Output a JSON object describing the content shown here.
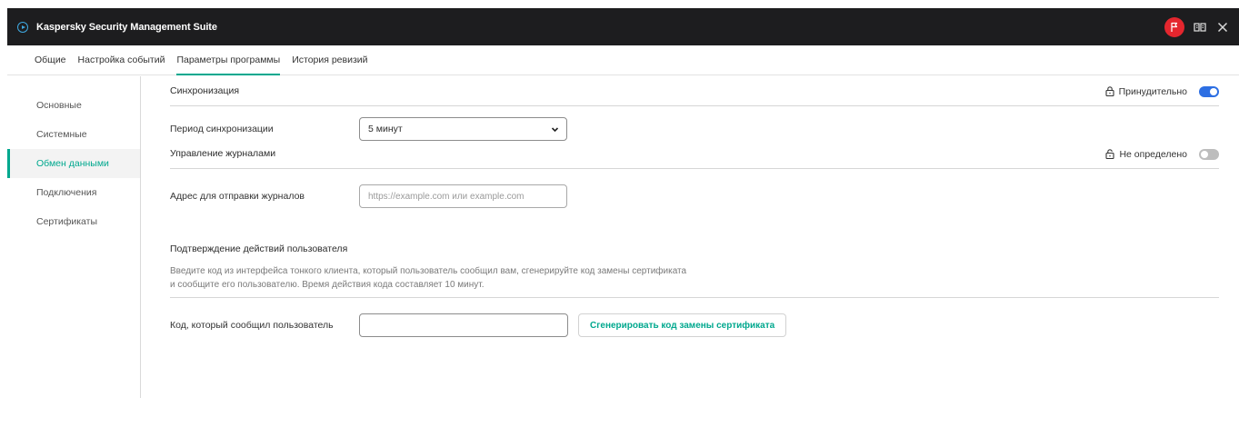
{
  "app": {
    "title": "Kaspersky Security Management Suite",
    "icons": [
      "play-circle-icon",
      "flag-icon",
      "book-icon",
      "close-icon"
    ],
    "colors": {
      "titlebar": "#1d1d1f",
      "accent": "#00a88e",
      "toggle_on": "#2d6fe3",
      "badge": "#e4262e"
    }
  },
  "tabs": [
    {
      "label": "Общие"
    },
    {
      "label": "Настройка событий"
    },
    {
      "label": "Параметры программы",
      "active": true
    },
    {
      "label": "История ревизий"
    }
  ],
  "sidebar": {
    "items": [
      {
        "label": "Основные"
      },
      {
        "label": "Системные"
      },
      {
        "label": "Обмен данными",
        "active": true
      },
      {
        "label": "Подключения"
      },
      {
        "label": "Сертификаты"
      }
    ]
  },
  "sync": {
    "section_title": "Синхронизация",
    "lock_label": "Принудительно",
    "lock_state": "locked",
    "toggle_on": true,
    "period_label": "Период синхронизации",
    "period_value": "5 минут"
  },
  "logs": {
    "section_title": "Управление журналами",
    "lock_label": "Не определено",
    "lock_state": "unlocked",
    "toggle_on": false,
    "address_label": "Адрес для отправки журналов",
    "address_placeholder": "https://example.com или example.com",
    "address_value": ""
  },
  "confirm": {
    "title": "Подтверждение действий пользователя",
    "description_line1": "Введите код из интерфейса тонкого клиента, который пользователь сообщил вам, сгенерируйте код замены сертификата",
    "description_line2": "и сообщите его пользователю. Время действия кода составляет 10 минут.",
    "code_label": "Код, который сообщил пользователь",
    "code_value": "",
    "generate_button": "Сгенерировать код замены сертификата"
  }
}
